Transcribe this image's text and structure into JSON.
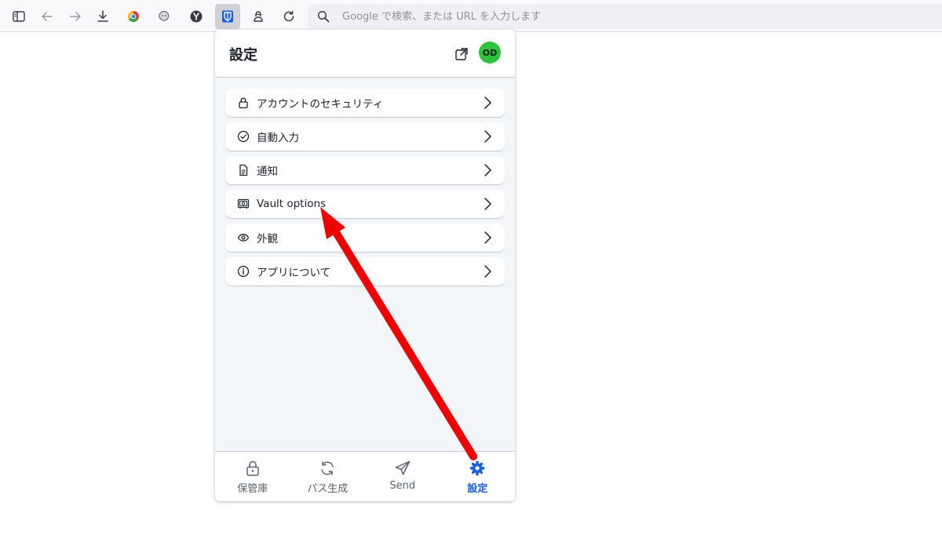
{
  "browser": {
    "url_placeholder": "Google で検索、または URL を入力します"
  },
  "popup": {
    "title": "設定",
    "avatar_initials": "OD",
    "avatar_color": "#2ec13b",
    "menu": [
      {
        "label": "アカウントのセキュリティ",
        "icon": "lock-icon"
      },
      {
        "label": "自動入力",
        "icon": "check-circle-icon"
      },
      {
        "label": "通知",
        "icon": "document-icon"
      },
      {
        "label": "Vault options",
        "icon": "vault-icon"
      },
      {
        "label": "外観",
        "icon": "eye-icon"
      },
      {
        "label": "アプリについて",
        "icon": "info-icon"
      }
    ],
    "nav": [
      {
        "label": "保管庫",
        "icon": "lock-icon"
      },
      {
        "label": "パス生成",
        "icon": "refresh-icon"
      },
      {
        "label": "Send",
        "icon": "send-icon"
      },
      {
        "label": "設定",
        "icon": "gear-icon",
        "active": true
      }
    ]
  },
  "colors": {
    "accent": "#175ddc",
    "annotation_arrow": "#ee0000"
  }
}
